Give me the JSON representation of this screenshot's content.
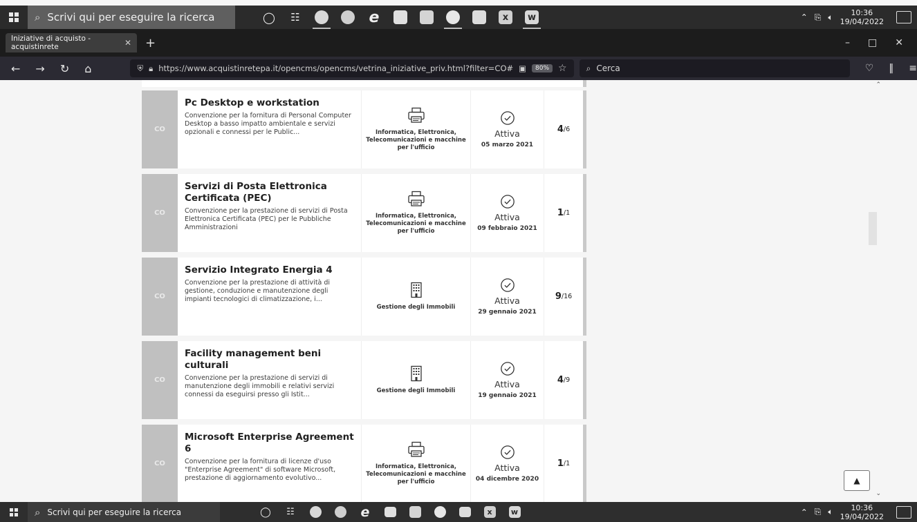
{
  "taskbar_top": {
    "search_placeholder": "Scrivi qui per eseguire la ricerca",
    "time": "10:36",
    "date": "19/04/2022"
  },
  "taskbar_bottom": {
    "search_placeholder": "Scrivi qui per eseguire la ricerca",
    "time": "10:36",
    "date": "19/04/2022"
  },
  "browser": {
    "tab_title": "Iniziative di acquisto - acquistinrete",
    "url": "https://www.acquistinretepa.it/opencms/opencms/vetrina_iniziative_priv.html?filter=CO#",
    "zoom": "80%",
    "search_placeholder": "Cerca"
  },
  "cards": [
    {
      "badge": "CO",
      "title": "Pc Desktop e workstation",
      "description": "Convenzione per la fornitura di Personal Computer Desktop a basso impatto ambientale e servizi opzionali e connessi per le Public...",
      "category": "Informatica, Elettronica, Telecomunicazioni e macchine per l'ufficio",
      "category_icon": "printer-icon",
      "status": "Attiva",
      "date": "05 marzo 2021",
      "count": "4",
      "total": "/6"
    },
    {
      "badge": "CO",
      "title": "Servizi di Posta Elettronica Certificata (PEC)",
      "description": "Convenzione per la prestazione di servizi di Posta Elettronica Certificata (PEC) per le Pubbliche Amministrazioni",
      "category": "Informatica, Elettronica, Telecomunicazioni e macchine per l'ufficio",
      "category_icon": "printer-icon",
      "status": "Attiva",
      "date": "09 febbraio 2021",
      "count": "1",
      "total": "/1"
    },
    {
      "badge": "CO",
      "title": "Servizio Integrato Energia 4",
      "description": "Convenzione per la prestazione di attività di gestione, conduzione e manutenzione degli impianti tecnologici di climatizzazione, i...",
      "category": "Gestione degli Immobili",
      "category_icon": "building-icon",
      "status": "Attiva",
      "date": "29 gennaio 2021",
      "count": "9",
      "total": "/16"
    },
    {
      "badge": "CO",
      "title": "Facility management beni culturali",
      "description": "Convenzione per la prestazione di servizi di manutenzione degli immobili e relativi servizi connessi da eseguirsi presso gli Istit...",
      "category": "Gestione degli Immobili",
      "category_icon": "building-icon",
      "status": "Attiva",
      "date": "19 gennaio 2021",
      "count": "4",
      "total": "/9"
    },
    {
      "badge": "CO",
      "title": "Microsoft Enterprise Agreement 6",
      "description": "Convenzione per la fornitura di licenze d'uso \"Enterprise Agreement\" di software Microsoft, prestazione di aggiornamento evolutivo...",
      "category": "Informatica, Elettronica, Telecomunicazioni e macchine per l'ufficio",
      "category_icon": "printer-icon",
      "status": "Attiva",
      "date": "04 dicembre 2020",
      "count": "1",
      "total": "/1"
    }
  ]
}
